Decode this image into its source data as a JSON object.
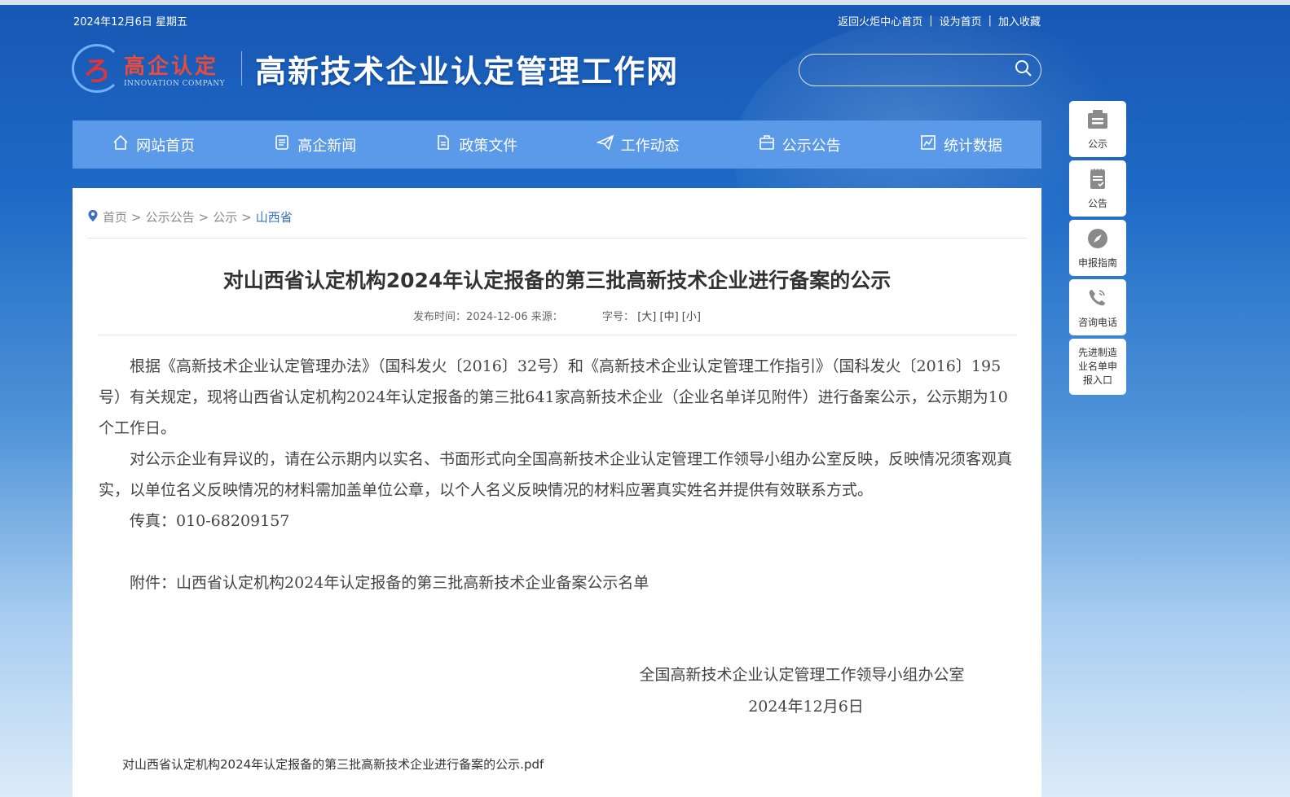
{
  "header": {
    "date": "2024年12月6日 星期五",
    "links": [
      "返回火炬中心首页",
      "设为首页",
      "加入收藏"
    ],
    "logo_cn": "高企认定",
    "logo_en": "INNOVATION COMPANY",
    "site_title": "高新技术企业认定管理工作网",
    "search_placeholder": ""
  },
  "nav": {
    "items": [
      {
        "label": "网站首页",
        "icon": "home-icon"
      },
      {
        "label": "高企新闻",
        "icon": "news-icon"
      },
      {
        "label": "政策文件",
        "icon": "document-icon"
      },
      {
        "label": "工作动态",
        "icon": "paper-plane-icon"
      },
      {
        "label": "公示公告",
        "icon": "briefcase-icon"
      },
      {
        "label": "统计数据",
        "icon": "chart-icon"
      }
    ]
  },
  "breadcrumb": [
    "首页",
    "公示公告",
    "公示",
    "山西省"
  ],
  "article": {
    "title": "对山西省认定机构2024年认定报备的第三批高新技术企业进行备案的公示",
    "publish_label": "发布时间：",
    "publish_date": "2024-12-06",
    "source_label": "来源：",
    "font_label": "字号：",
    "font_sizes": [
      "[大]",
      "[中]",
      "[小]"
    ],
    "paragraphs": [
      "根据《高新技术企业认定管理办法》（国科发火〔2016〕32号）和《高新技术企业认定管理工作指引》（国科发火〔2016〕195号）有关规定，现将山西省认定机构2024年认定报备的第三批641家高新技术企业（企业名单详见附件）进行备案公示，公示期为10个工作日。",
      "对公示企业有异议的，请在公示期内以实名、书面形式向全国高新技术企业认定管理工作领导小组办公室反映，反映情况须客观真实，以单位名义反映情况的材料需加盖单位公章，以个人名义反映情况的材料应署真实姓名并提供有效联系方式。"
    ],
    "fax": "传真：010-68209157",
    "attachment": "附件：山西省认定机构2024年认定报备的第三批高新技术企业备案公示名单",
    "signature_org": "全国高新技术企业认定管理工作领导小组办公室",
    "signature_date": "2024年12月6日",
    "pdf_link": "对山西省认定机构2024年认定报备的第三批高新技术企业进行备案的公示.pdf"
  },
  "side_panel": [
    {
      "label": "公示",
      "icon": "notice-board-icon"
    },
    {
      "label": "公告",
      "icon": "clipboard-icon"
    },
    {
      "label": "申报指南",
      "icon": "compass-icon"
    },
    {
      "label": "咨询电话",
      "icon": "phone-icon"
    },
    {
      "label": "先进制造业名单申报入口",
      "icon": ""
    }
  ]
}
